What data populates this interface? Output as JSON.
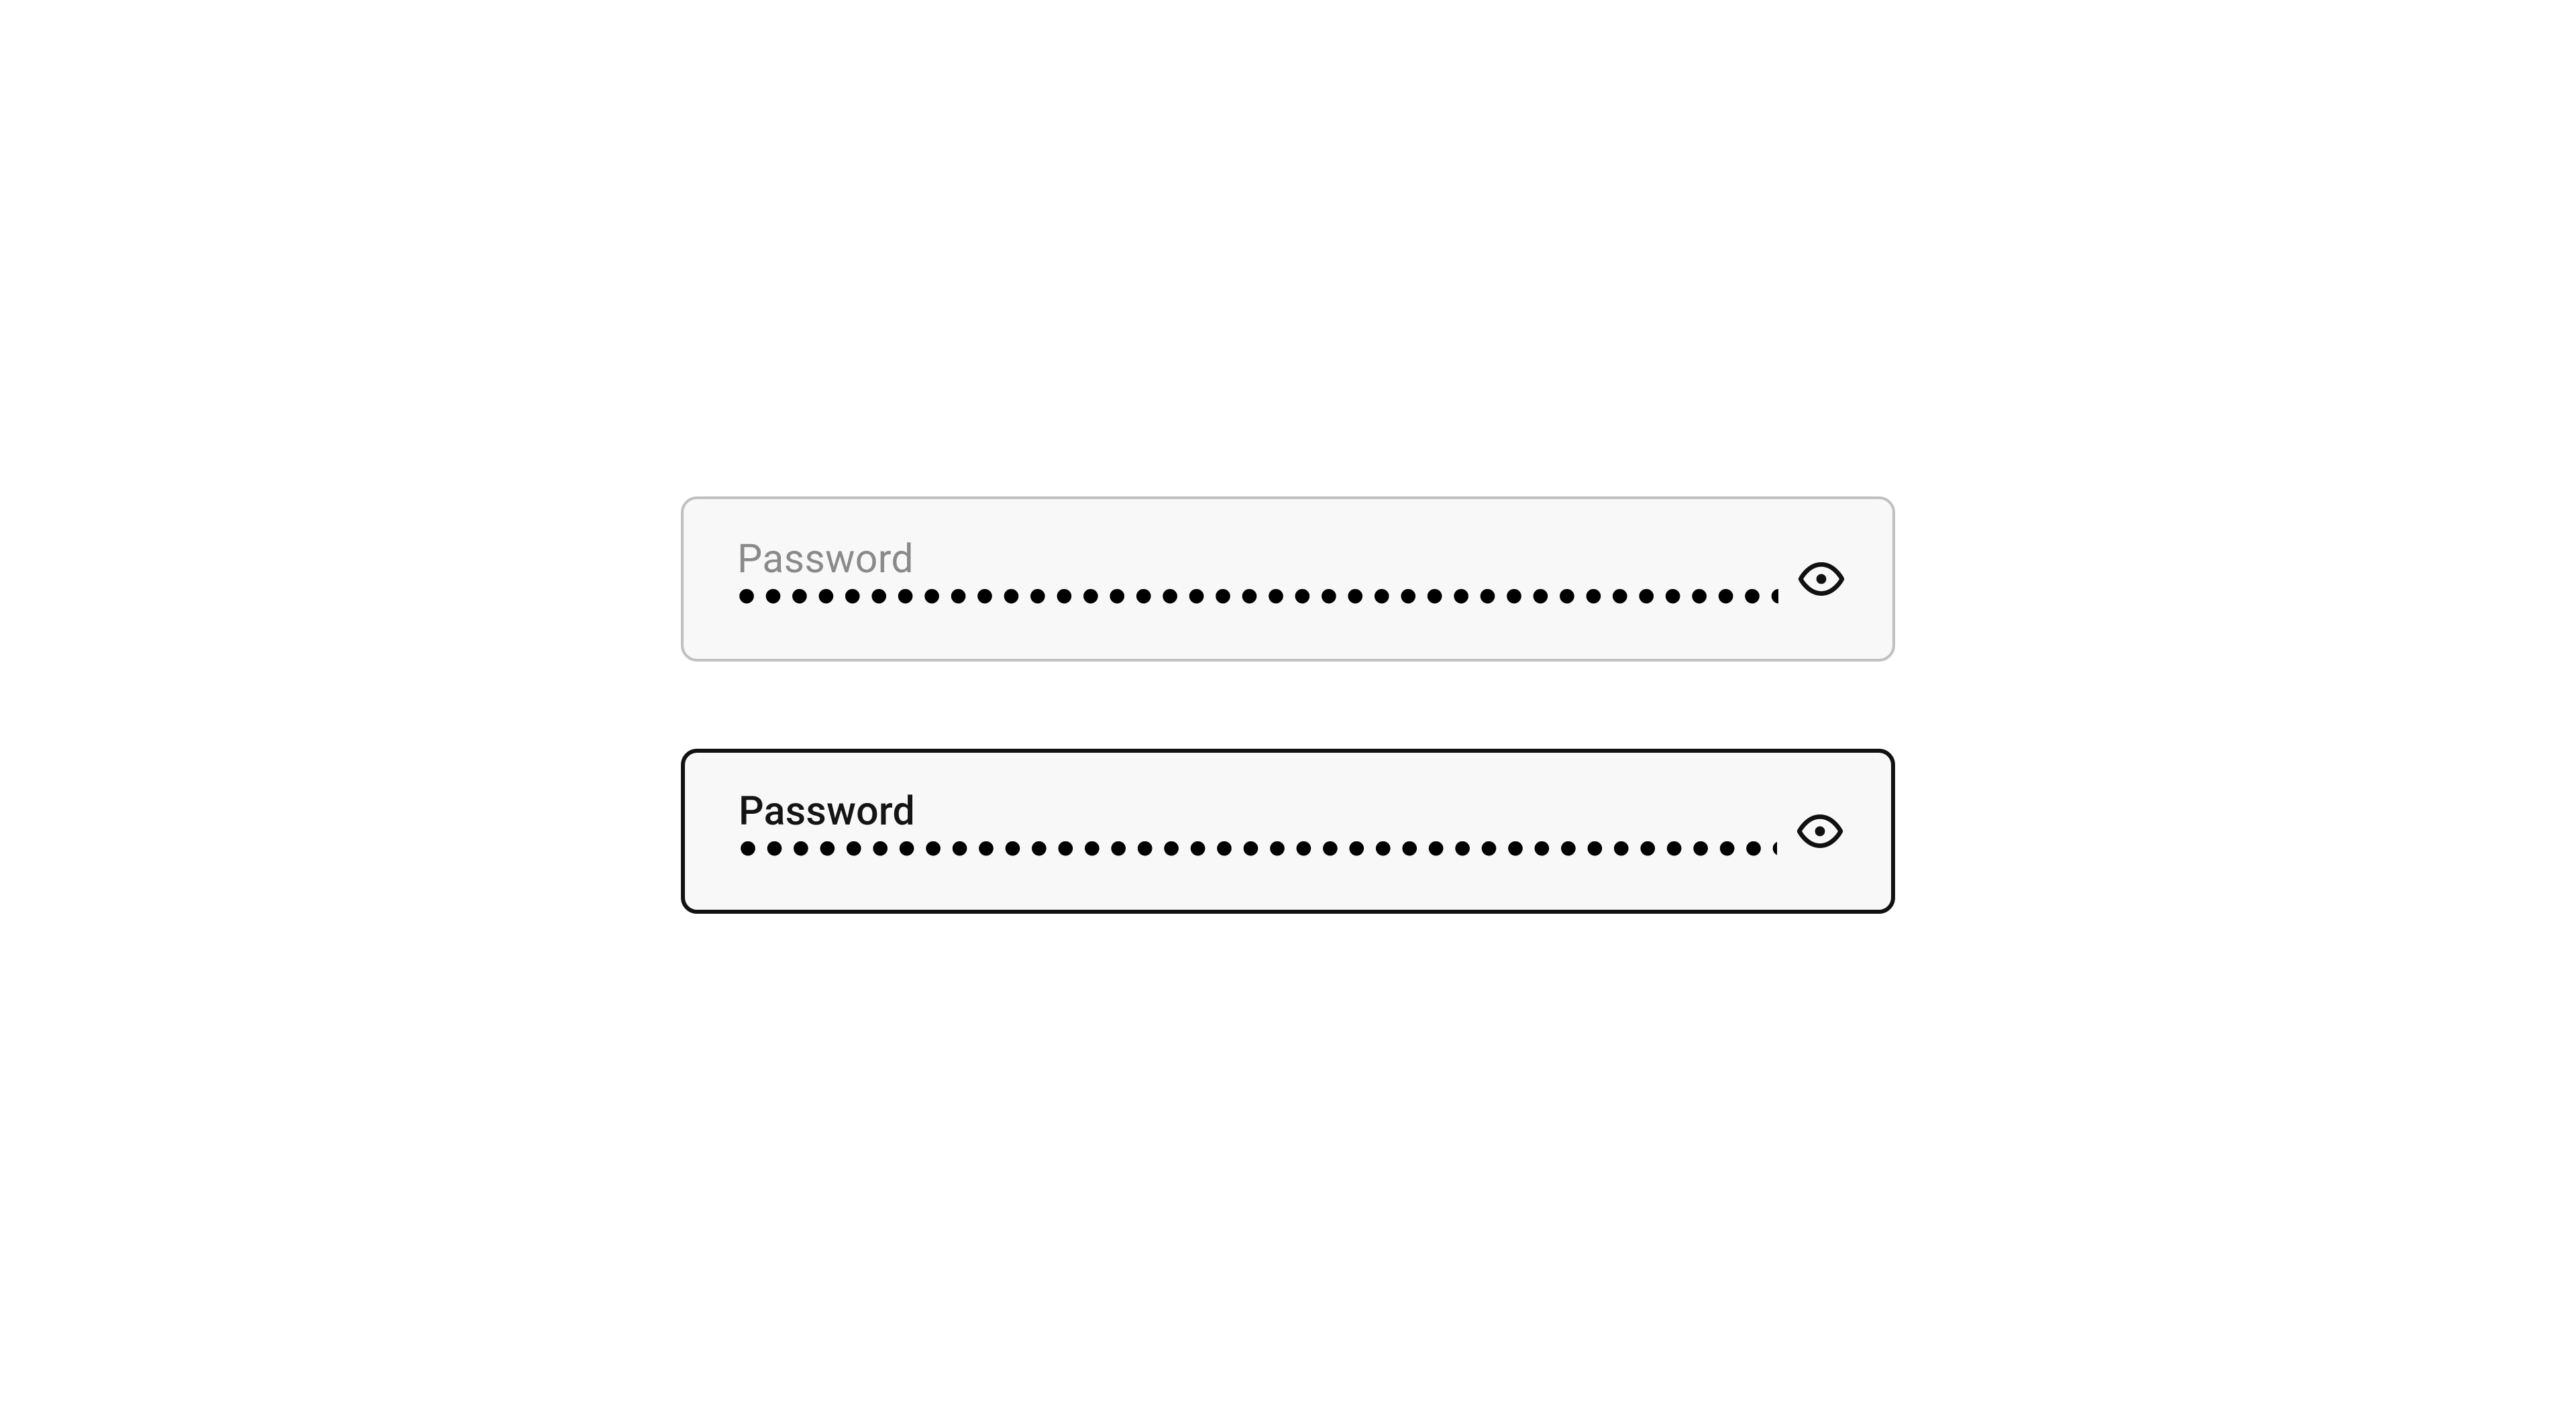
{
  "fields": [
    {
      "label": "Password",
      "masked_value": "•••••••••••••••••••••••••••••••••••••••••••••••••••••••••••••••",
      "state": "inactive",
      "show_caret": false
    },
    {
      "label": "Password",
      "masked_value": "•••••••••••••••••••••••••••••••••••••••••••••••••••••••••••••••",
      "state": "active",
      "show_caret": true
    }
  ],
  "icons": {
    "eye": "eye-icon"
  }
}
